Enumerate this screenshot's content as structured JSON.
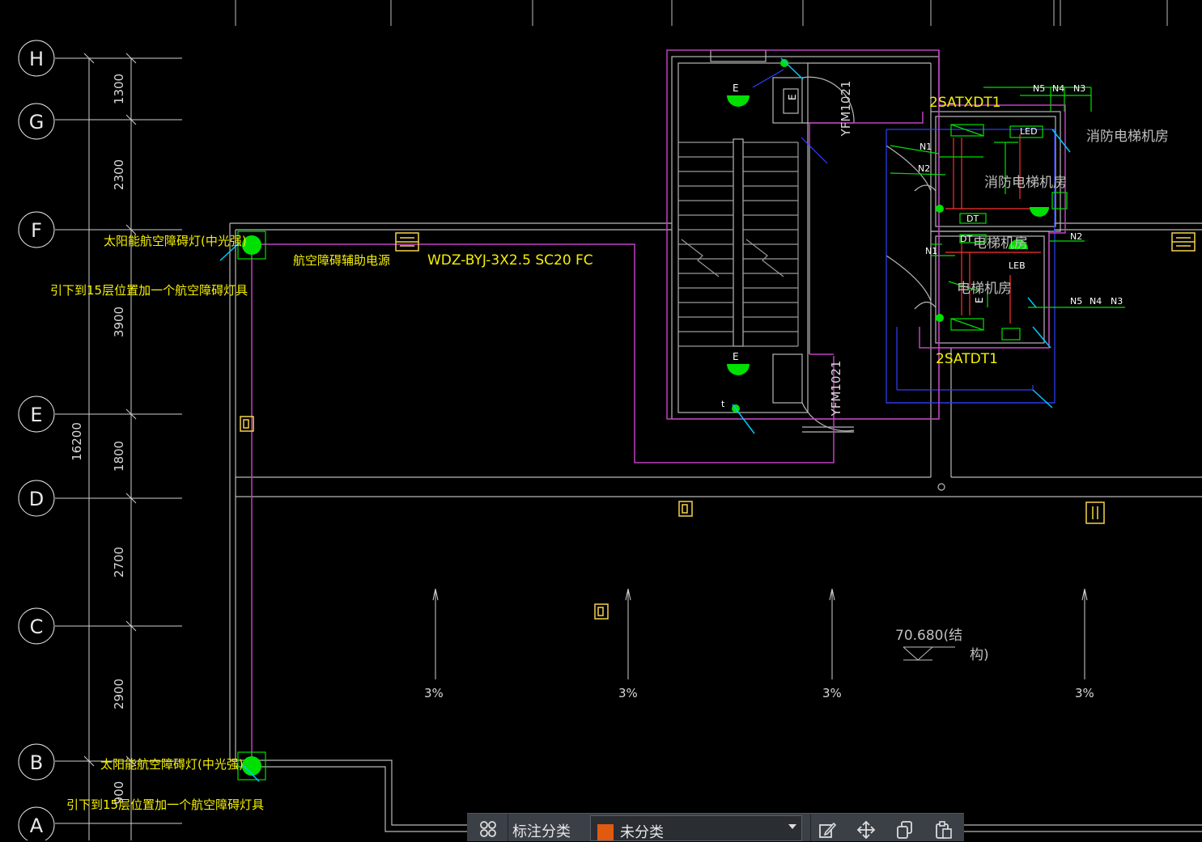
{
  "axes": {
    "bubbles": [
      "H",
      "G",
      "F",
      "E",
      "D",
      "C",
      "B",
      "A"
    ],
    "spacings": [
      "1300",
      "2300",
      "3900",
      "1800",
      "2700",
      "2900",
      "900"
    ],
    "total": "16200"
  },
  "annotations": {
    "beacon_top": "太阳能航空障碍灯(中光强)",
    "beacon_top_note": "引下到15层位置加一个航空障碍灯具",
    "aux_power": "航空障碍辅助电源",
    "cable": "WDZ-BYJ-3X2.5 SC20 FC",
    "beacon_bottom": "太阳能航空障碍灯(中光强)",
    "beacon_bottom_note": "引下到15层位置加一个航空障碍灯具",
    "panel_top": "2SATXDT1",
    "panel_bottom": "2SATDT1",
    "fire_elevator_room": "消防电梯机房",
    "fire_elevator_room_inner": "消防电梯机房",
    "elevator_room_1": "电梯机房",
    "elevator_room_2": "电梯机房",
    "door_top": "YFM1021",
    "door_bottom": "YFM1021",
    "exit_e1": "E",
    "exit_e2": "E",
    "exit_e3": "E",
    "exit_e4": "E",
    "led_top": "LED",
    "led_bottom": "LEB",
    "dt_1": "DT",
    "dt_2": "DT",
    "n_labels_top": [
      "N5",
      "N4",
      "N3"
    ],
    "n_labels_bottom": [
      "N5",
      "N4",
      "N3"
    ],
    "n1_top": "N1",
    "n2_top": "N2",
    "n1_bottom": "N1",
    "n2_right": "N2",
    "slopes": [
      "3%",
      "3%",
      "3%",
      "3%"
    ],
    "elevation_value": "70.680(结",
    "elevation_suffix": "构)"
  },
  "toolbar": {
    "label": "标注分类",
    "selected": "未分类",
    "selected_color": "#e05a10",
    "tools": [
      "edit-icon",
      "move-icon",
      "copy-icon",
      "paste-icon"
    ]
  },
  "colors": {
    "background": "#000000",
    "wire": "#c040c0",
    "lamp": "#00e000",
    "text_yellow": "#f5f000",
    "wall": "#b8b8b8"
  }
}
